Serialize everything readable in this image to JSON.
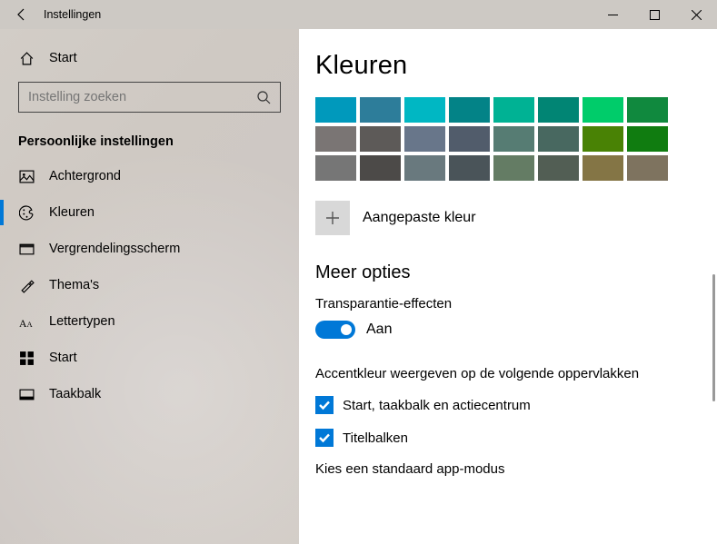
{
  "window": {
    "title": "Instellingen"
  },
  "sidebar": {
    "home": "Start",
    "search_placeholder": "Instelling zoeken",
    "group_header": "Persoonlijke instellingen",
    "items": [
      {
        "label": "Achtergrond",
        "icon": "picture-icon"
      },
      {
        "label": "Kleuren",
        "icon": "palette-icon"
      },
      {
        "label": "Vergrendelingsscherm",
        "icon": "lock-screen-icon"
      },
      {
        "label": "Thema's",
        "icon": "themes-icon"
      },
      {
        "label": "Lettertypen",
        "icon": "font-icon"
      },
      {
        "label": "Start",
        "icon": "start-menu-icon"
      },
      {
        "label": "Taakbalk",
        "icon": "taskbar-icon"
      }
    ],
    "selected_index": 1
  },
  "content": {
    "title": "Kleuren",
    "palette": [
      [
        "#0099bc",
        "#2d7d9a",
        "#00b7c3",
        "#038387",
        "#00b294",
        "#018574",
        "#00cc6a",
        "#10893e"
      ],
      [
        "#7a7574",
        "#5d5a58",
        "#68768a",
        "#515c6b",
        "#567c73",
        "#486860",
        "#498205",
        "#107c10"
      ],
      [
        "#767676",
        "#4c4a48",
        "#69797e",
        "#4a5459",
        "#647c64",
        "#525e54",
        "#847545",
        "#7e735f"
      ]
    ],
    "custom_color_label": "Aangepaste kleur",
    "more_options_header": "Meer opties",
    "transparency_label": "Transparantie-effecten",
    "toggle_state_label": "Aan",
    "accent_surfaces_header": "Accentkleur weergeven op de volgende oppervlakken",
    "checkbox1_label": "Start, taakbalk en actiecentrum",
    "checkbox2_label": "Titelbalken",
    "app_mode_label": "Kies een standaard app-modus"
  }
}
